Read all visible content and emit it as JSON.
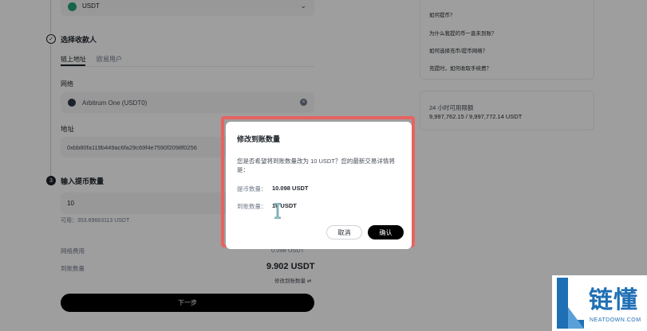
{
  "coin": {
    "selected": "USDT"
  },
  "recipient": {
    "step_title": "选择收款人",
    "tabs": [
      {
        "label": "链上地址",
        "active": true
      },
      {
        "label": "欧易用户",
        "active": false
      }
    ],
    "network_label": "网络",
    "network_value": "Arbitrum One (USDT0)",
    "address_label": "地址",
    "address_value": "0xbb80fa119b449ac6fa29c69f4e7590f2098f0256"
  },
  "amount": {
    "step_number": "3",
    "step_title": "输入提币数量",
    "value": "10",
    "available": "可用：353.69663113 USDT",
    "fee_label": "网络费用",
    "fee_value": "0.098 USDT",
    "received_label": "到账数量",
    "received_value": "9.902 USDT",
    "edit_link": "修改到账数量",
    "edit_icon": "swap-icon"
  },
  "next_button": "下一步",
  "faq": [
    "如何提币？",
    "为什么我提的币一直未到账？",
    "如何选择充币/提币网络？",
    "充提时，如何收取手续费？"
  ],
  "limit": {
    "title": "24 小时可用限额",
    "value": "9,997,762.15 / 9,997,772.14 USDT"
  },
  "modal": {
    "title": "修改到账数量",
    "body": "您是否希望将到账数量改为 10 USDT？您的最新交易详情将是：",
    "withdraw_label": "提币数量：",
    "withdraw_value": "10.098 USDT",
    "receive_label": "到账数量：",
    "receive_value": "10 USDT",
    "cancel": "取消",
    "confirm": "确认"
  },
  "watermark": {
    "brand": "链懂",
    "site": "NEATDOWN.COM"
  },
  "colors": {
    "highlight": "#e8625f",
    "primary": "#000000",
    "network_icon": "#2d374b"
  }
}
